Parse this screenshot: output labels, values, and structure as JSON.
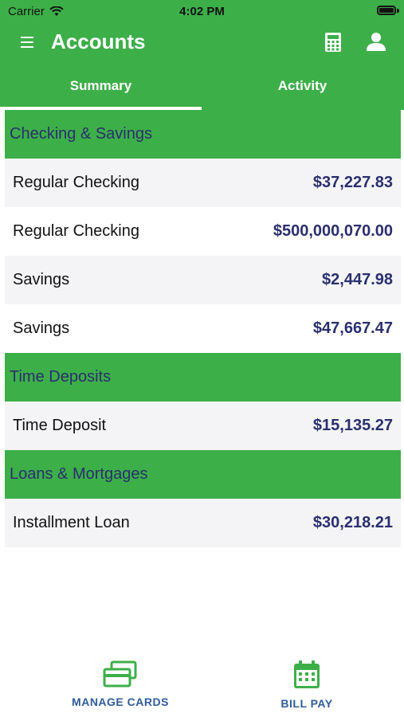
{
  "status_bar": {
    "carrier": "Carrier",
    "time": "4:02 PM"
  },
  "header": {
    "title": "Accounts"
  },
  "tabs": [
    {
      "label": "Summary",
      "selected": true
    },
    {
      "label": "Activity",
      "selected": false
    }
  ],
  "colors": {
    "brand_green": "#3daf49",
    "navy": "#2a2f6e",
    "nav_blue": "#2f5c9a"
  },
  "sections": [
    {
      "title": "Checking & Savings",
      "accounts": [
        {
          "name": "Regular Checking",
          "amount": "$37,227.83"
        },
        {
          "name": "Regular Checking",
          "amount": "$500,000,070.00"
        },
        {
          "name": "Savings",
          "amount": "$2,447.98"
        },
        {
          "name": "Savings",
          "amount": "$47,667.47"
        }
      ]
    },
    {
      "title": "Time Deposits",
      "accounts": [
        {
          "name": "Time Deposit",
          "amount": "$15,135.27"
        }
      ]
    },
    {
      "title": "Loans & Mortgages",
      "accounts": [
        {
          "name": "Installment Loan",
          "amount": "$30,218.21"
        }
      ]
    }
  ],
  "bottom_nav": [
    {
      "label": "MANAGE CARDS",
      "icon": "credit-cards-icon"
    },
    {
      "label": "BILL PAY",
      "icon": "calendar-icon"
    }
  ]
}
